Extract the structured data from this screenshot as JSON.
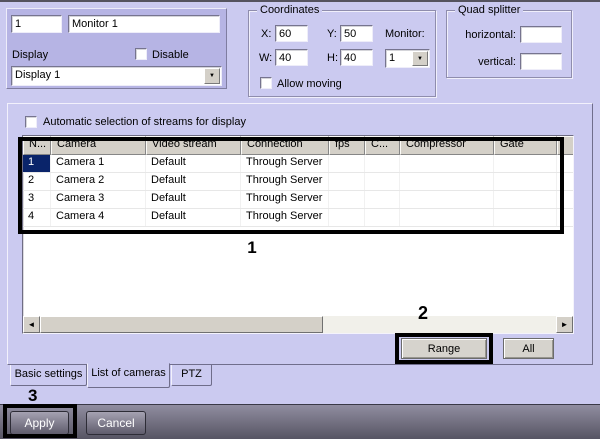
{
  "monitor": {
    "id_value": "1",
    "name_value": "Monitor 1",
    "display_label": "Display",
    "disable_label": "Disable",
    "display_select_value": "Display 1"
  },
  "coordinates": {
    "title": "Coordinates",
    "x_label": "X:",
    "x_value": "60",
    "y_label": "Y:",
    "y_value": "50",
    "w_label": "W:",
    "w_value": "40",
    "h_label": "H:",
    "h_value": "40",
    "monitor_label": "Monitor:",
    "monitor_value": "1",
    "allow_moving_label": "Allow moving"
  },
  "quad_splitter": {
    "title": "Quad splitter",
    "horizontal_label": "horizontal:",
    "horizontal_value": "",
    "vertical_label": "vertical:",
    "vertical_value": ""
  },
  "cameras_tab": {
    "auto_select_label": "Automatic selection of streams for display",
    "table": {
      "columns": [
        "N...",
        "Camera",
        "Video stream",
        "Connection",
        "fps",
        "C...",
        "Compressor",
        "Gate"
      ],
      "rows": [
        {
          "n": "1",
          "camera": "Camera 1",
          "video_stream": "Default",
          "connection": "Through Server",
          "fps": "",
          "c": "",
          "compressor": "",
          "gate": ""
        },
        {
          "n": "2",
          "camera": "Camera 2",
          "video_stream": "Default",
          "connection": "Through Server",
          "fps": "",
          "c": "",
          "compressor": "",
          "gate": ""
        },
        {
          "n": "3",
          "camera": "Camera 3",
          "video_stream": "Default",
          "connection": "Through Server",
          "fps": "",
          "c": "",
          "compressor": "",
          "gate": ""
        },
        {
          "n": "4",
          "camera": "Camera 4",
          "video_stream": "Default",
          "connection": "Through Server",
          "fps": "",
          "c": "",
          "compressor": "",
          "gate": ""
        }
      ]
    },
    "range_button": "Range",
    "all_button": "All"
  },
  "tabs": [
    {
      "label": "Basic settings"
    },
    {
      "label": "List of cameras"
    },
    {
      "label": "PTZ"
    }
  ],
  "footer": {
    "apply_label": "Apply",
    "cancel_label": "Cancel"
  },
  "annotations": {
    "one": "1",
    "two": "2",
    "three": "3"
  },
  "icons": {
    "dropdown": "▼",
    "scroll_left": "◄",
    "scroll_right": "►"
  },
  "colors": {
    "dialog_bg": "#cbcaf0",
    "group_bg": "#b6b4e4",
    "selection": "#0a246a",
    "header_gray": "#d4d0c8",
    "annotation": "#000000",
    "footer_top": "#908da0",
    "footer_bottom": "#53515f"
  }
}
